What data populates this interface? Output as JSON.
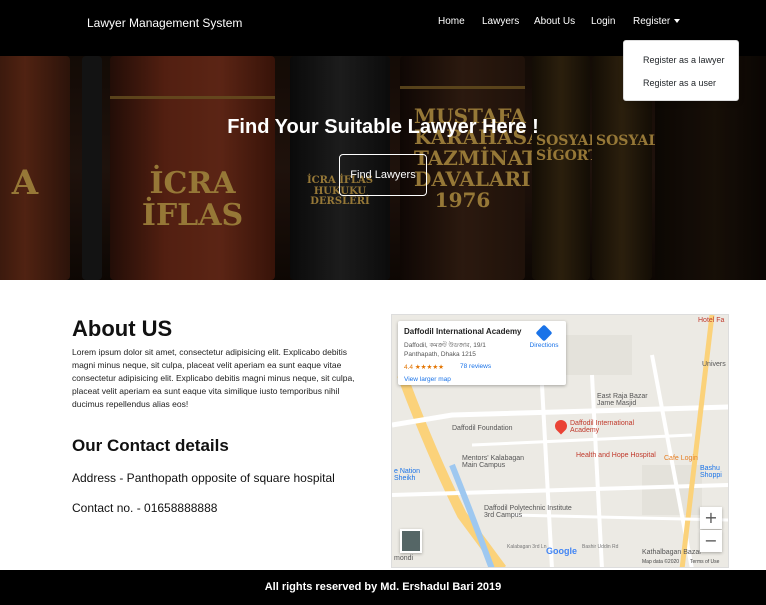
{
  "navbar": {
    "brand": "Lawyer Management System",
    "links": [
      "Home",
      "Lawyers",
      "About Us",
      "Login"
    ],
    "register": "Register"
  },
  "dropdown": {
    "items": [
      "Register as a lawyer",
      "Register as a user"
    ]
  },
  "hero": {
    "title": "Find Your Suitable Lawyer Here !",
    "button": "Find Lawyers",
    "books": [
      "A",
      "İCRA İFLAS",
      "İCRA İFLAS HUKUKU DERSLERİ",
      "MUSTAFA KARAHASAN TAZMİNAT DAVALARI 1976",
      "SOSYAL SİGORTA",
      "SOSYAL"
    ]
  },
  "about": {
    "title": "About US",
    "text": "Lorem ipsum dolor sit amet, consectetur adipisicing elit. Explicabo debitis magni minus neque, sit culpa, placeat velit aperiam ea sunt eaque vitae consectetur adipisicing elit. Explicabo debitis magni minus neque, sit culpa, placeat velit aperiam ea sunt eaque vita similique iusto temporibus nihil ducimus repellendus alias eos!"
  },
  "contact": {
    "title": "Our Contact details",
    "address": "Address - Panthopath opposite of square hospital",
    "phone": "Contact no. - 01658888888"
  },
  "map": {
    "place_name": "Daffodil International Academy",
    "place_address": "Daffodil, কমক্রট উডজার, 19/1 Panthapath, Dhaka 1215",
    "rating": "4.4 ★★★★★",
    "reviews": "78 reviews",
    "directions": "Directions",
    "view_larger": "View larger map",
    "labels": {
      "hotel": "Hotel Fa",
      "univ": "Univers",
      "east_raja": "East Raja Bazar Jame Masjid",
      "daffodil_foundation": "Daffodil Foundation",
      "daffodil_intl": "Daffodil International Academy",
      "health_hope": "Health and Hope Hospital",
      "cafe": "Cafe Login",
      "mentors": "Mentors' Kalabagan Main Campus",
      "e_nation": "e Nation Sheikh",
      "polytechnic": "Daffodil Polytechnic Institute 3rd Campus",
      "bashu": "Bashu Shoppi",
      "kathalbagan": "Kathalbagan Bazar",
      "google": "Google",
      "mapdata": "Map data ©2020",
      "terms": "Terms of Use",
      "bashir": "Bashir Uddin Rd",
      "kalabagan_st": "Kalabagan 3rd Ln",
      "mondi": "mondi"
    },
    "zoom_in": "+",
    "zoom_out": "−"
  },
  "footer": {
    "text": "All rights reserved by Md. Ershadul Bari 2019"
  },
  "colors": {
    "navbar_bg": "#000000",
    "footer_bg": "#000000",
    "link": "#1a73e8",
    "pin": "#ea4335"
  }
}
